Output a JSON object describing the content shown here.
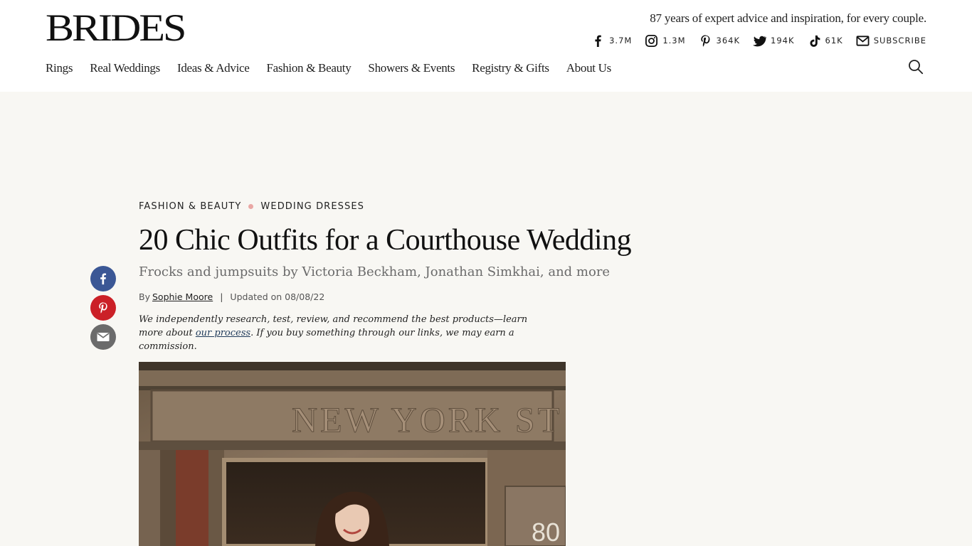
{
  "header": {
    "logo": "BRIDES",
    "tagline": "87 years of expert advice and inspiration, for every couple.",
    "social": [
      {
        "icon": "facebook-icon",
        "count": "3.7M"
      },
      {
        "icon": "instagram-icon",
        "count": "1.3M"
      },
      {
        "icon": "pinterest-icon",
        "count": "364K"
      },
      {
        "icon": "twitter-icon",
        "count": "194K"
      },
      {
        "icon": "tiktok-icon",
        "count": "61K"
      },
      {
        "icon": "mail-icon",
        "count": "SUBSCRIBE"
      }
    ],
    "nav": [
      "Rings",
      "Real Weddings",
      "Ideas & Advice",
      "Fashion & Beauty",
      "Showers & Events",
      "Registry & Gifts",
      "About Us"
    ]
  },
  "share": {
    "colors": {
      "facebook": "#3b5795",
      "pinterest": "#cb2027",
      "email": "#6b6b6b"
    }
  },
  "article": {
    "breadcrumb": [
      "FASHION & BEAUTY",
      "WEDDING DRESSES"
    ],
    "title": "20 Chic Outfits for a Courthouse Wedding",
    "subtitle": "Frocks and jumpsuits by Victoria Beckham, Jonathan Simkhai, and more",
    "byline_prefix": "By",
    "author": "Sophie Moore",
    "separator": "|",
    "updated": "Updated on 08/08/22",
    "disclaimer_part1": "We independently research, test, review, and recommend the best products—learn more about ",
    "disclaimer_link": "our process",
    "disclaimer_part2": ". If you buy something through our links, we may earn a commission.",
    "hero_building_text": "NEW YORK ST",
    "hero_address": "80"
  }
}
